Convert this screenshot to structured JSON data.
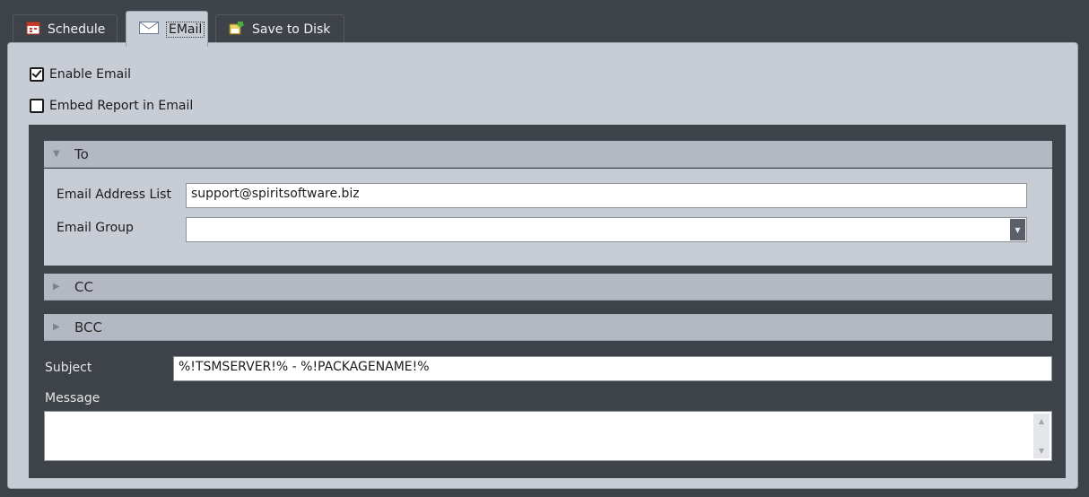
{
  "tabs": [
    {
      "label": "Schedule",
      "icon": "calendar-icon"
    },
    {
      "label": "EMail",
      "icon": "envelope-icon"
    },
    {
      "label": "Save to Disk",
      "icon": "save-to-disk-icon"
    }
  ],
  "active_tab": "EMail",
  "options": {
    "enable_email_label": "Enable Email",
    "enable_email_checked": true,
    "embed_report_label": "Embed Report in Email",
    "embed_report_checked": false
  },
  "sections": {
    "to": {
      "title": "To",
      "expanded": true,
      "email_address_list_label": "Email Address List",
      "email_address_list_value": "support@spiritsoftware.biz",
      "email_group_label": "Email Group",
      "email_group_value": ""
    },
    "cc": {
      "title": "CC",
      "expanded": false
    },
    "bcc": {
      "title": "BCC",
      "expanded": false
    }
  },
  "subject": {
    "label": "Subject",
    "value": "%!TSMSERVER!% - %!PACKAGENAME!%"
  },
  "message": {
    "label": "Message",
    "value": ""
  },
  "colors": {
    "panel_bg": "#c8ccd5",
    "frame_bg": "#3e4249",
    "section_header_bg": "#b3b8c2"
  }
}
